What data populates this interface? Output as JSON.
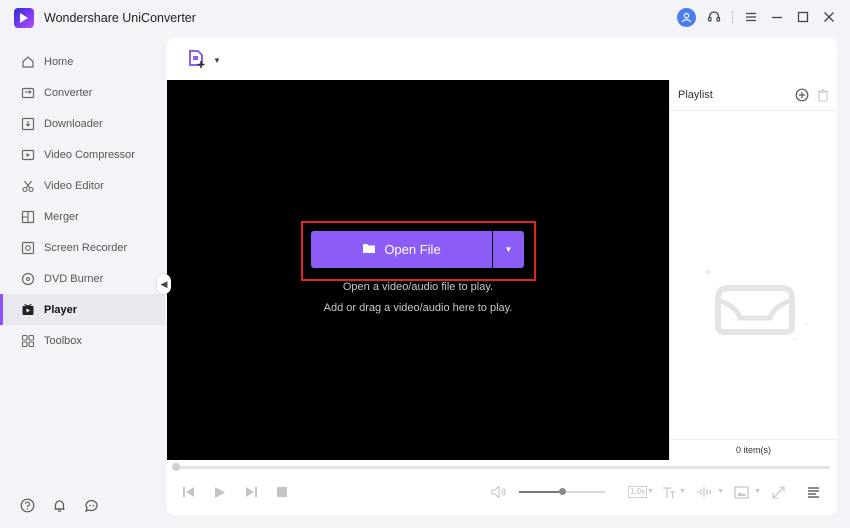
{
  "app": {
    "title": "Wondershare UniConverter"
  },
  "titlebar": {
    "icons": [
      "user-icon",
      "headset-icon",
      "menu-icon",
      "minimize-icon",
      "maximize-icon",
      "close-icon"
    ]
  },
  "sidebar": {
    "items": [
      {
        "label": "Home",
        "icon": "home-icon",
        "active": false
      },
      {
        "label": "Converter",
        "icon": "converter-icon",
        "active": false
      },
      {
        "label": "Downloader",
        "icon": "downloader-icon",
        "active": false
      },
      {
        "label": "Video Compressor",
        "icon": "compress-icon",
        "active": false
      },
      {
        "label": "Video Editor",
        "icon": "scissors-icon",
        "active": false
      },
      {
        "label": "Merger",
        "icon": "merger-icon",
        "active": false
      },
      {
        "label": "Screen Recorder",
        "icon": "record-icon",
        "active": false
      },
      {
        "label": "DVD Burner",
        "icon": "disc-icon",
        "active": false
      },
      {
        "label": "Player",
        "icon": "player-icon",
        "active": true
      },
      {
        "label": "Toolbox",
        "icon": "toolbox-icon",
        "active": false
      }
    ],
    "bottom_icons": [
      "help-icon",
      "bell-icon",
      "feedback-icon"
    ]
  },
  "player": {
    "open_button_label": "Open File",
    "hint_line1": "Open a video/audio file to play.",
    "hint_line2": "Add or drag a video/audio here to play.",
    "progress": 0.0,
    "volume": 0.5,
    "speed_label": "1.0x"
  },
  "playlist": {
    "title": "Playlist",
    "count_label": "0 item(s)"
  },
  "colors": {
    "accent": "#8c5cf6",
    "highlight_border": "#e02424",
    "video_bg": "#000000"
  }
}
